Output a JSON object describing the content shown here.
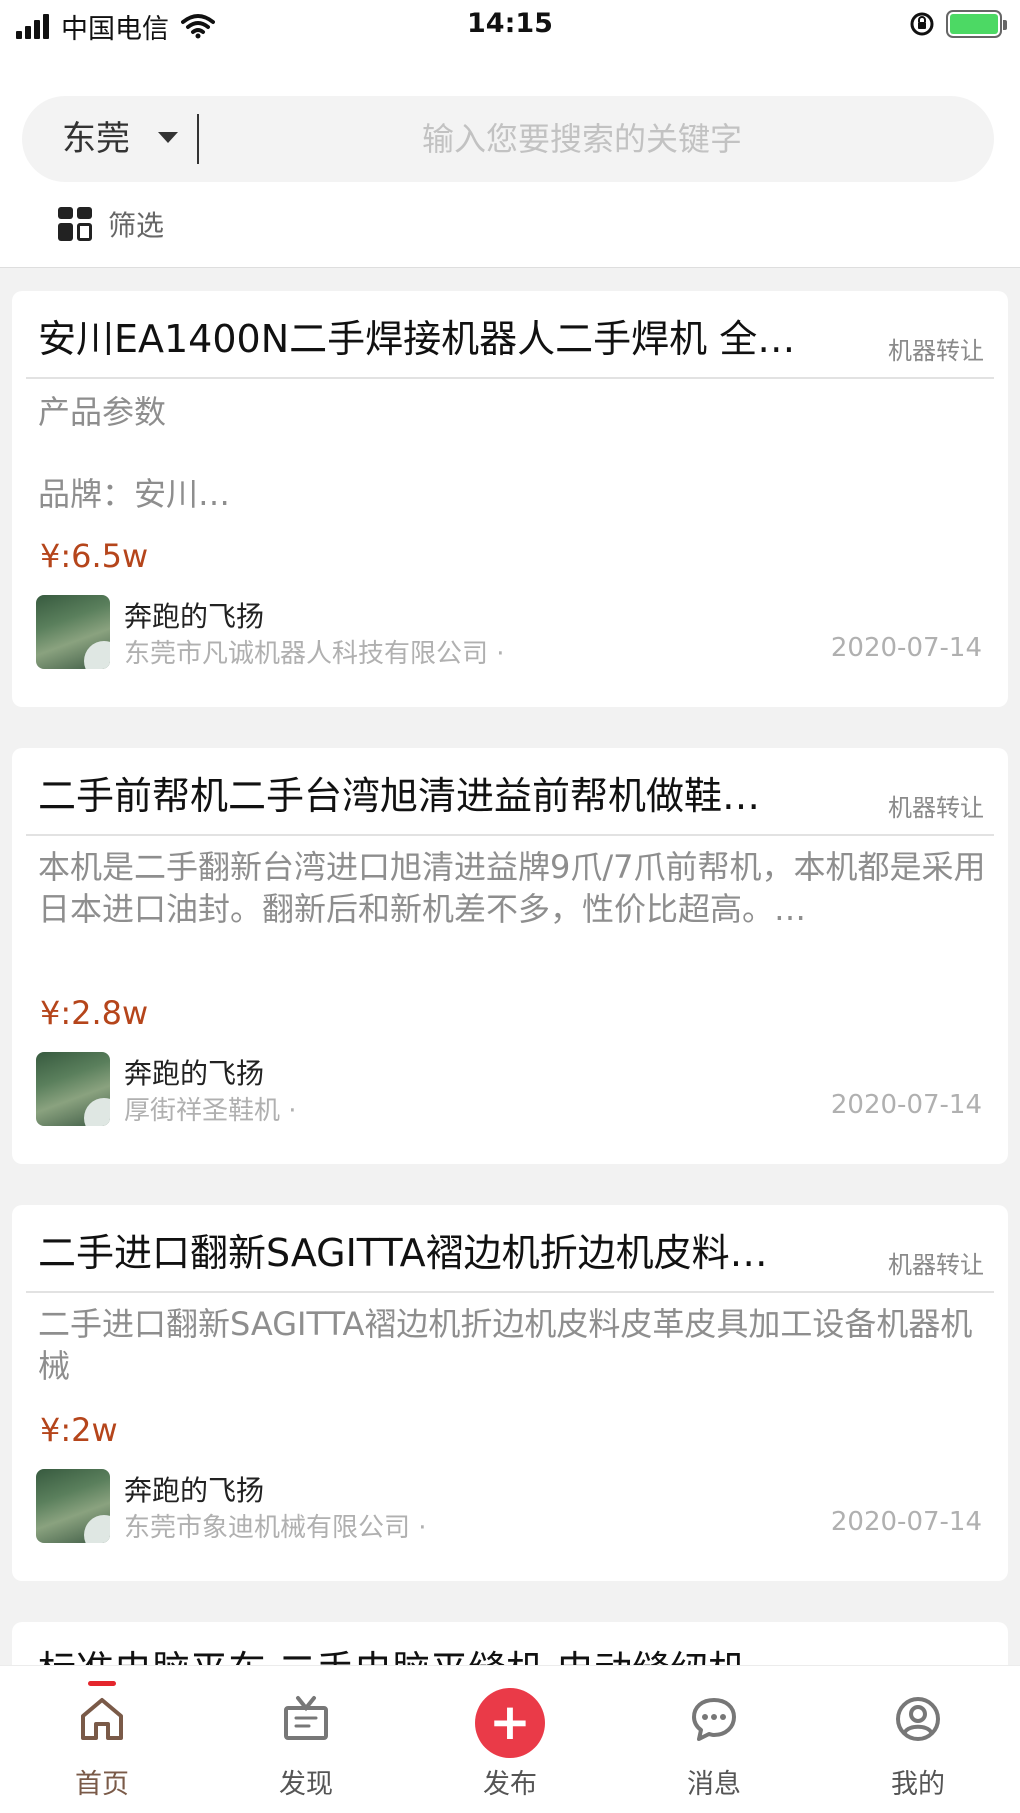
{
  "status_bar": {
    "carrier": "中国电信",
    "time": "14:15"
  },
  "search": {
    "city": "东莞",
    "placeholder": "输入您要搜索的关键字",
    "filter_label": "筛选"
  },
  "listings": [
    {
      "title": "安川EA1400N二手焊接机器人二手焊机 全…",
      "tag": "机器转让",
      "description_lines": [
        "产品参数",
        "品牌：安川…"
      ],
      "price": "¥:6.5w",
      "seller_name": "奔跑的飞扬",
      "company": "东莞市凡诚机器人科技有限公司 ·",
      "date": "2020-07-14"
    },
    {
      "title": "二手前帮机二手台湾旭清进益前帮机做鞋…",
      "tag": "机器转让",
      "description_lines": [
        "本机是二手翻新台湾进口旭清进益牌9爪/7爪前帮机，本机都是采用日本进口油封。翻新后和新机差不多，性价比超高。…"
      ],
      "price": "¥:2.8w",
      "seller_name": "奔跑的飞扬",
      "company": "厚街祥圣鞋机 ·",
      "date": "2020-07-14"
    },
    {
      "title": "二手进口翻新SAGITTA褶边机折边机皮料…",
      "tag": "机器转让",
      "description_lines": [
        "二手进口翻新SAGITTA褶边机折边机皮料皮革皮具加工设备机器机械"
      ],
      "price": "¥:2w",
      "seller_name": "奔跑的飞扬",
      "company": "东莞市象迪机械有限公司 ·",
      "date": "2020-07-14"
    },
    {
      "title": "标准电脑平车 二手电脑平缝机 电动缝纫机"
    }
  ],
  "tab_bar": {
    "items": [
      {
        "label": "首页",
        "icon": "home-icon",
        "active": true
      },
      {
        "label": "发现",
        "icon": "tv-icon",
        "active": false
      },
      {
        "label": "发布",
        "icon": "plus-icon",
        "active": false
      },
      {
        "label": "消息",
        "icon": "chat-bubble-icon",
        "active": false
      },
      {
        "label": "我的",
        "icon": "user-icon",
        "active": false
      }
    ],
    "publish_symbol": "+"
  },
  "colors": {
    "price": "#b5451b",
    "publish_button": "#ea3a48",
    "active_indicator": "#e4262d",
    "battery_fill": "#4cd964"
  }
}
